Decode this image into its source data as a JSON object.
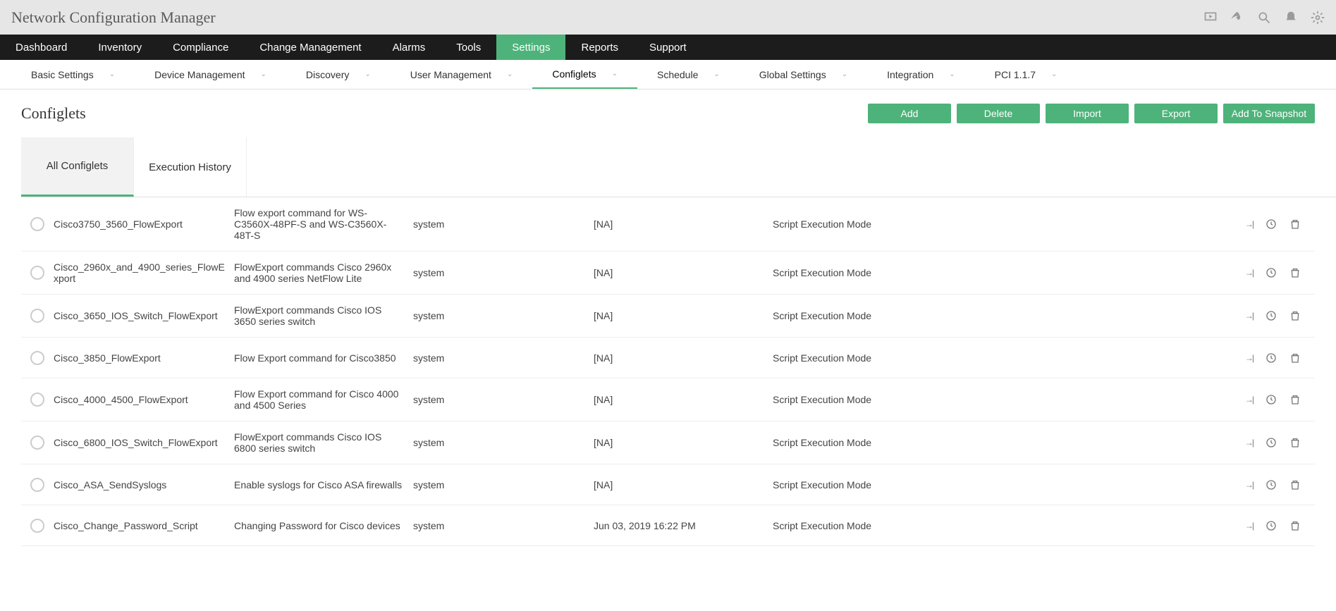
{
  "app_title": "Network Configuration Manager",
  "main_nav": [
    {
      "label": "Dashboard"
    },
    {
      "label": "Inventory"
    },
    {
      "label": "Compliance"
    },
    {
      "label": "Change Management"
    },
    {
      "label": "Alarms"
    },
    {
      "label": "Tools"
    },
    {
      "label": "Settings",
      "active": true
    },
    {
      "label": "Reports"
    },
    {
      "label": "Support"
    }
  ],
  "sub_nav": [
    {
      "label": "Basic Settings"
    },
    {
      "label": "Device Management"
    },
    {
      "label": "Discovery"
    },
    {
      "label": "User Management"
    },
    {
      "label": "Configlets",
      "active": true
    },
    {
      "label": "Schedule"
    },
    {
      "label": "Global Settings"
    },
    {
      "label": "Integration"
    },
    {
      "label": "PCI 1.1.7"
    }
  ],
  "page_title": "Configlets",
  "buttons": {
    "add": "Add",
    "delete": "Delete",
    "import": "Import",
    "export": "Export",
    "snapshot": "Add To Snapshot"
  },
  "tabs": {
    "all": "All Configlets",
    "history": "Execution History"
  },
  "rows": [
    {
      "name": "Cisco3750_3560_FlowExport",
      "desc": "Flow export command for WS-C3560X-48PF-S and WS-C3560X-48T-S",
      "owner": "system",
      "date": "[NA]",
      "mode": "Script Execution Mode"
    },
    {
      "name": "Cisco_2960x_and_4900_series_FlowExport",
      "desc": "FlowExport commands Cisco 2960x and 4900 series NetFlow Lite",
      "owner": "system",
      "date": "[NA]",
      "mode": "Script Execution Mode"
    },
    {
      "name": "Cisco_3650_IOS_Switch_FlowExport",
      "desc": "FlowExport commands Cisco IOS 3650 series switch",
      "owner": "system",
      "date": "[NA]",
      "mode": "Script Execution Mode"
    },
    {
      "name": "Cisco_3850_FlowExport",
      "desc": "Flow Export command for Cisco3850",
      "owner": "system",
      "date": "[NA]",
      "mode": "Script Execution Mode"
    },
    {
      "name": "Cisco_4000_4500_FlowExport",
      "desc": "Flow Export command for Cisco 4000 and 4500 Series",
      "owner": "system",
      "date": "[NA]",
      "mode": "Script Execution Mode"
    },
    {
      "name": "Cisco_6800_IOS_Switch_FlowExport",
      "desc": "FlowExport commands Cisco IOS 6800 series switch",
      "owner": "system",
      "date": "[NA]",
      "mode": "Script Execution Mode"
    },
    {
      "name": "Cisco_ASA_SendSyslogs",
      "desc": "Enable syslogs for Cisco ASA firewalls",
      "owner": "system",
      "date": "[NA]",
      "mode": "Script Execution Mode"
    },
    {
      "name": "Cisco_Change_Password_Script",
      "desc": "Changing Password for Cisco devices",
      "owner": "system",
      "date": "Jun 03, 2019 16:22 PM",
      "mode": "Script Execution Mode"
    }
  ]
}
